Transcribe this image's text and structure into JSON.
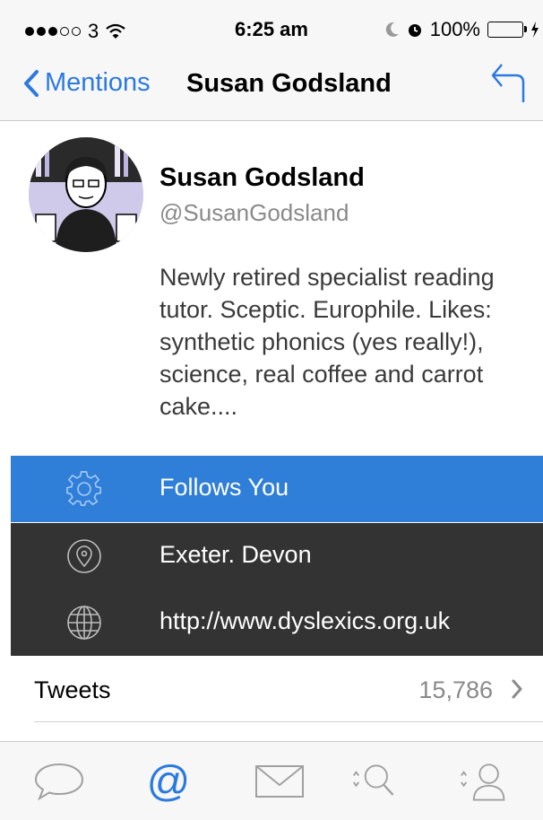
{
  "status_bar": {
    "carrier": "3",
    "time": "6:25 am",
    "battery": "100%"
  },
  "nav": {
    "back_label": "Mentions",
    "title": "Susan Godsland"
  },
  "profile": {
    "name": "Susan Godsland",
    "handle": "@SusanGodsland",
    "bio": "Newly retired specialist reading tutor. Sceptic. Europhile. Likes: synthetic phonics (yes really!), science, real coffee and carrot cake...."
  },
  "info_rows": [
    {
      "icon": "gear-icon",
      "label": "Follows You"
    },
    {
      "icon": "location-pin-icon",
      "label": "Exeter. Devon"
    },
    {
      "icon": "globe-icon",
      "label": "http://www.dyslexics.org.uk"
    }
  ],
  "tweets": {
    "label": "Tweets",
    "count": "15,786"
  },
  "tabs": [
    {
      "icon": "speech-bubble-icon",
      "active": false
    },
    {
      "icon": "at-sign-icon",
      "active": true
    },
    {
      "icon": "envelope-icon",
      "active": false
    },
    {
      "icon": "search-icon",
      "active": false
    },
    {
      "icon": "user-icon",
      "active": false
    }
  ],
  "colors": {
    "accent": "#2c7ae0",
    "highlight_row": "#2f7ed8",
    "dark_row": "#333333",
    "tab_icon": "#a0a0a0"
  }
}
